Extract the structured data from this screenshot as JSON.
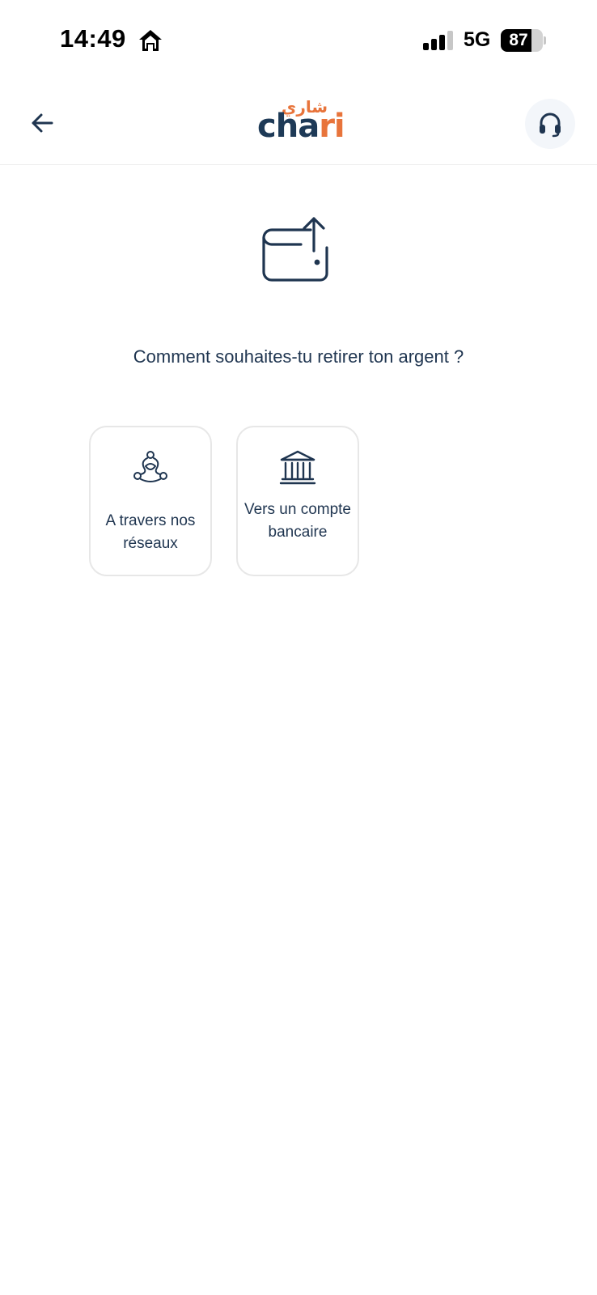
{
  "status_bar": {
    "time": "14:49",
    "network": "5G",
    "battery_percent": 87,
    "battery_label": "87"
  },
  "header": {
    "logo_latin_main": "cha",
    "logo_latin_accent": "ri",
    "logo_arabic": "شاري"
  },
  "main": {
    "question": "Comment souhaites-tu retirer ton argent ?",
    "options": [
      {
        "label": "A travers nos réseaux",
        "icon": "network-icon"
      },
      {
        "label": "Vers un compte bancaire",
        "icon": "bank-icon"
      }
    ]
  },
  "colors": {
    "primary": "#1f3550",
    "accent": "#e8743b",
    "card_border": "#e7e7e7",
    "support_bg": "#f3f6fa"
  }
}
